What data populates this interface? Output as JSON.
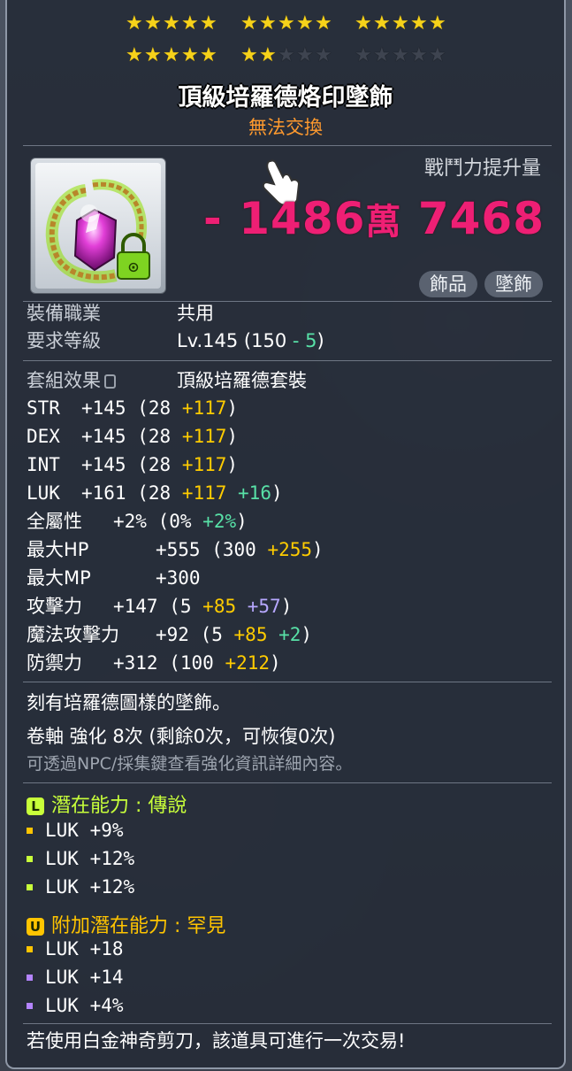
{
  "item": {
    "star_force": {
      "filled": 22,
      "max": 30
    },
    "name": "頂級培羅德烙印墜飾",
    "trade_status": "無法交換",
    "power_label": "戰鬥力提升量",
    "power_sign": "-",
    "power_main": "1486",
    "power_unit": "萬",
    "power_rest": "7468",
    "tags": [
      "飾品",
      "墜飾"
    ],
    "job_label": "裝備職業",
    "job_value": "共用",
    "level_label": "要求等級",
    "level_prefix": "Lv.145 (150 ",
    "level_minus": "- 5",
    "level_suffix": ")",
    "set_label": "套組效果",
    "set_value": "頂級培羅德套裝",
    "stats": [
      {
        "name": "STR",
        "total": "+145",
        "base": "(28 ",
        "bonus": "+117",
        "extra": "",
        "extra_color": "",
        "close": ")"
      },
      {
        "name": "DEX",
        "total": "+145",
        "base": "(28 ",
        "bonus": "+117",
        "extra": "",
        "extra_color": "",
        "close": ")"
      },
      {
        "name": "INT",
        "total": "+145",
        "base": "(28 ",
        "bonus": "+117",
        "extra": "",
        "extra_color": "",
        "close": ")"
      },
      {
        "name": "LUK",
        "total": "+161",
        "base": "(28 ",
        "bonus": "+117",
        "extra": " +16",
        "extra_color": "green",
        "close": ")"
      },
      {
        "name": "全屬性",
        "total": "+2%",
        "base": "(0% ",
        "bonus": "",
        "extra": "+2%",
        "extra_color": "green",
        "close": ")"
      },
      {
        "name": "最大HP",
        "total": "+555",
        "base": "(300 ",
        "bonus": "+255",
        "extra": "",
        "extra_color": "",
        "close": ")"
      },
      {
        "name": "最大MP",
        "total": "+300",
        "base": "",
        "bonus": "",
        "extra": "",
        "extra_color": "",
        "close": ""
      },
      {
        "name": "攻擊力",
        "total": "+147",
        "base": "(5 ",
        "bonus": "+85",
        "extra": " +57",
        "extra_color": "purple",
        "close": ")"
      },
      {
        "name": "魔法攻擊力",
        "total": "+92",
        "base": "(5 ",
        "bonus": "+85",
        "extra": " +2",
        "extra_color": "green",
        "close": ")"
      },
      {
        "name": "防禦力",
        "total": "+312",
        "base": "(100 ",
        "bonus": "+212",
        "extra": "",
        "extra_color": "",
        "close": ")"
      }
    ],
    "description": "刻有培羅德圖樣的墜飾。",
    "scroll_line": "卷軸 強化 8次 (剩餘0次，可恢復0次)",
    "hint_line": "可透過NPC/採集鍵查看強化資訊詳細內容。",
    "potential": {
      "badge": "L",
      "label": "潛在能力 : 傳說",
      "color": "#c8ff3a",
      "lines": [
        {
          "text": "LUK +9%",
          "bullet": "#ffc400"
        },
        {
          "text": "LUK +12%",
          "bullet": "#c8ff3a"
        },
        {
          "text": "LUK +12%",
          "bullet": "#c8ff3a"
        }
      ]
    },
    "bonus_potential": {
      "badge": "U",
      "label": "附加潛在能力 : 罕見",
      "color": "#ffc400",
      "lines": [
        {
          "text": "LUK +18",
          "bullet": "#ffc400"
        },
        {
          "text": "LUK +14",
          "bullet": "#b484ff"
        },
        {
          "text": "LUK +4%",
          "bullet": "#b484ff"
        }
      ]
    },
    "footer": "若使用白金神奇剪刀，該道具可進行一次交易!"
  }
}
